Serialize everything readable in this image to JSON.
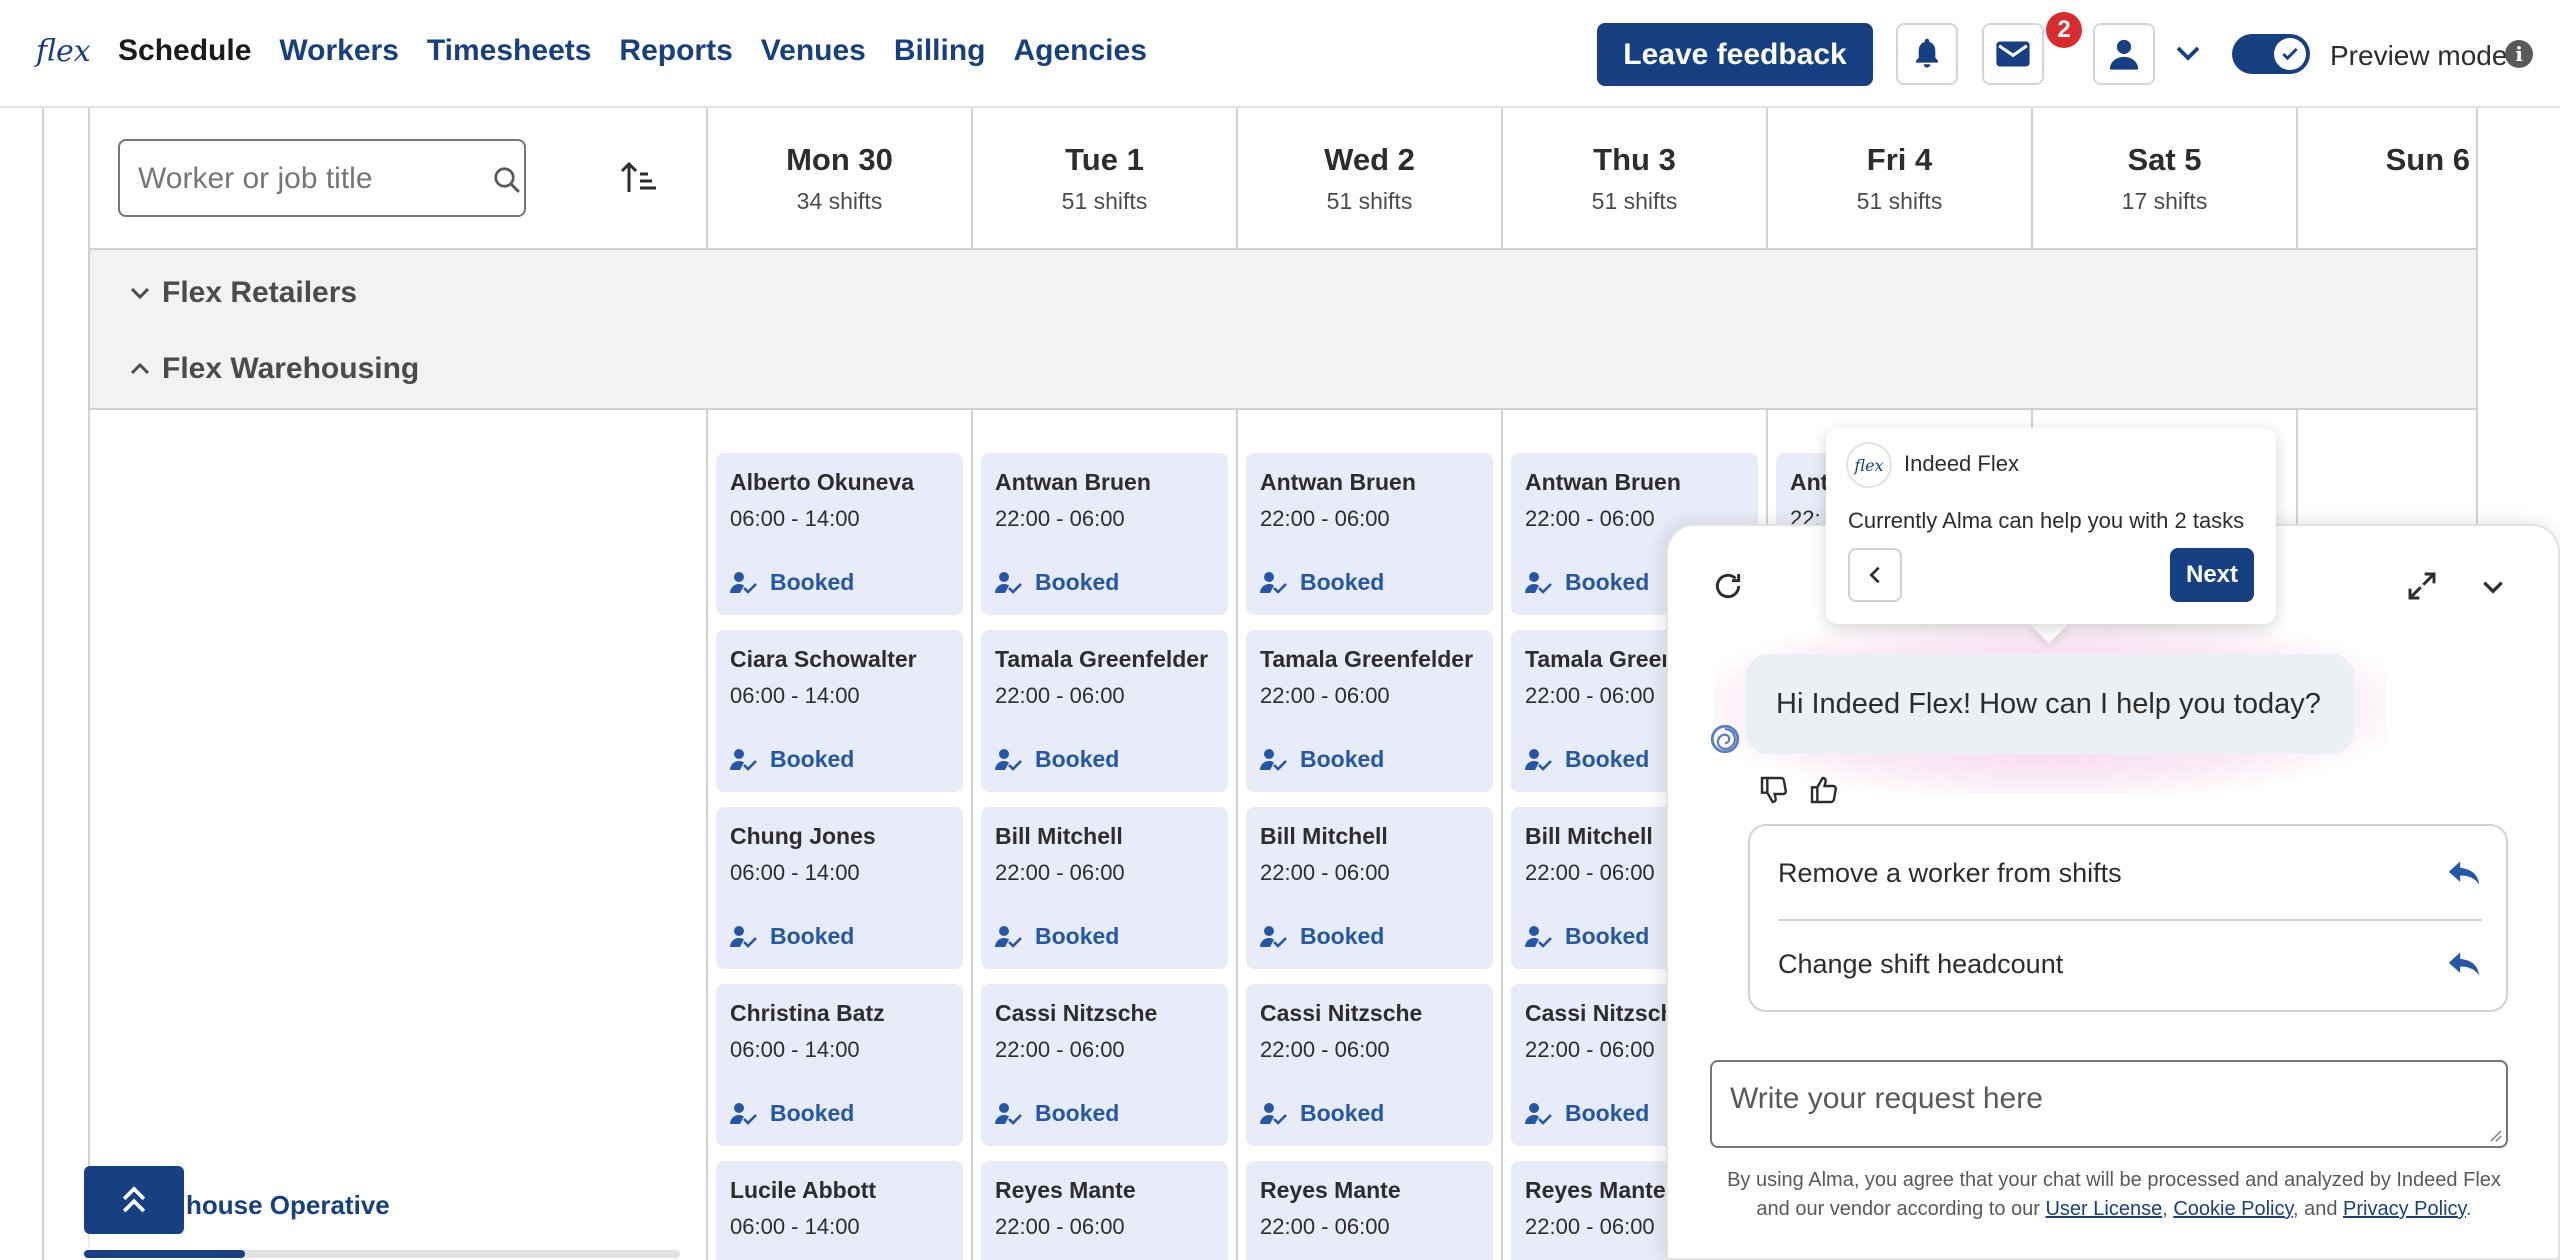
{
  "nav": {
    "logo": "flex",
    "links": [
      "Schedule",
      "Workers",
      "Timesheets",
      "Reports",
      "Venues",
      "Billing",
      "Agencies"
    ],
    "active": "Schedule",
    "feedback_label": "Leave feedback",
    "message_badge": "2",
    "preview_label": "Preview mode",
    "preview_enabled": true,
    "info_glyph": "i",
    "icons": [
      "bell-icon",
      "mail-icon",
      "user-icon",
      "chevron-down-icon",
      "check-icon",
      "info-icon"
    ]
  },
  "schedule": {
    "search_placeholder": "Worker or job title",
    "days": [
      {
        "name": "Mon 30",
        "count": "34 shifts"
      },
      {
        "name": "Tue 1",
        "count": "51 shifts"
      },
      {
        "name": "Wed 2",
        "count": "51 shifts"
      },
      {
        "name": "Thu 3",
        "count": "51 shifts"
      },
      {
        "name": "Fri 4",
        "count": "51 shifts"
      },
      {
        "name": "Sat 5",
        "count": "17 shifts"
      },
      {
        "name": "Sun 6",
        "count": ""
      }
    ],
    "groups": [
      {
        "name": "Flex Retailers",
        "expanded": false
      },
      {
        "name": "Flex Warehousing",
        "expanded": true
      }
    ],
    "columns": [
      [
        {
          "name": "Alberto Okuneva",
          "time": "06:00 - 14:00",
          "status": "Booked"
        },
        {
          "name": "Ciara Schowalter",
          "time": "06:00 - 14:00",
          "status": "Booked"
        },
        {
          "name": "Chung Jones",
          "time": "06:00 - 14:00",
          "status": "Booked"
        },
        {
          "name": "Christina Batz",
          "time": "06:00 - 14:00",
          "status": "Booked"
        },
        {
          "name": "Lucile Abbott",
          "time": "06:00 - 14:00",
          "status": ""
        }
      ],
      [
        {
          "name": "Antwan Bruen",
          "time": "22:00 - 06:00",
          "status": "Booked"
        },
        {
          "name": "Tamala Greenfelder",
          "time": "22:00 - 06:00",
          "status": "Booked"
        },
        {
          "name": "Bill Mitchell",
          "time": "22:00 - 06:00",
          "status": "Booked"
        },
        {
          "name": "Cassi Nitzsche",
          "time": "22:00 - 06:00",
          "status": "Booked"
        },
        {
          "name": "Reyes Mante",
          "time": "22:00 - 06:00",
          "status": ""
        }
      ],
      [
        {
          "name": "Antwan Bruen",
          "time": "22:00 - 06:00",
          "status": "Booked"
        },
        {
          "name": "Tamala Greenfelder",
          "time": "22:00 - 06:00",
          "status": "Booked"
        },
        {
          "name": "Bill Mitchell",
          "time": "22:00 - 06:00",
          "status": "Booked"
        },
        {
          "name": "Cassi Nitzsche",
          "time": "22:00 - 06:00",
          "status": "Booked"
        },
        {
          "name": "Reyes Mante",
          "time": "22:00 - 06:00",
          "status": ""
        }
      ],
      [
        {
          "name": "Antwan Bruen",
          "time": "22:00 - 06:00",
          "status": "Booked"
        },
        {
          "name": "Tamala Green",
          "time": "22:00 - 06:00",
          "status": "Booked"
        },
        {
          "name": "Bill Mitchell",
          "time": "22:00 - 06:00",
          "status": "Booked"
        },
        {
          "name": "Cassi Nitzsche",
          "time": "22:00 - 06:00",
          "status": "Booked"
        },
        {
          "name": "Reyes Mante",
          "time": "22:00 - 06:00",
          "status": ""
        }
      ],
      [
        {
          "name": "Ant",
          "time": "22:",
          "status": ""
        }
      ]
    ],
    "role_label": "house Operative",
    "scroll_progress": 0.27
  },
  "chat": {
    "greeting": "Hi Indeed Flex! How can I help you today?",
    "tasks": [
      "Remove a worker from shifts",
      "Change shift headcount"
    ],
    "input_placeholder": "Write your request here",
    "disclaimer_line1": "By using Alma, you agree that your chat will be processed and analyzed by Indeed Flex",
    "disclaimer_pre": "and our vendor according to our",
    "link_user_license": "User License",
    "sep_comma": ",",
    "link_cookie": "Cookie Policy",
    "sep_and": ", and",
    "link_privacy": "Privacy Policy",
    "end_period": ".",
    "icons": [
      "refresh-icon",
      "expand-icon",
      "chevron-down-icon",
      "alma-spiral-icon",
      "thumbs-down-icon",
      "thumbs-up-icon",
      "reply-arrow-icon"
    ]
  },
  "tooltip": {
    "logo": "flex",
    "title": "Indeed Flex",
    "text": "Currently Alma can help you with 2 tasks",
    "next_label": "Next"
  },
  "colors": {
    "brand": "#164081",
    "badge": "#d92b2b",
    "card_bg": "#e8ecf8",
    "status_text": "#2557a7",
    "group_band": "#f3f2f1"
  }
}
